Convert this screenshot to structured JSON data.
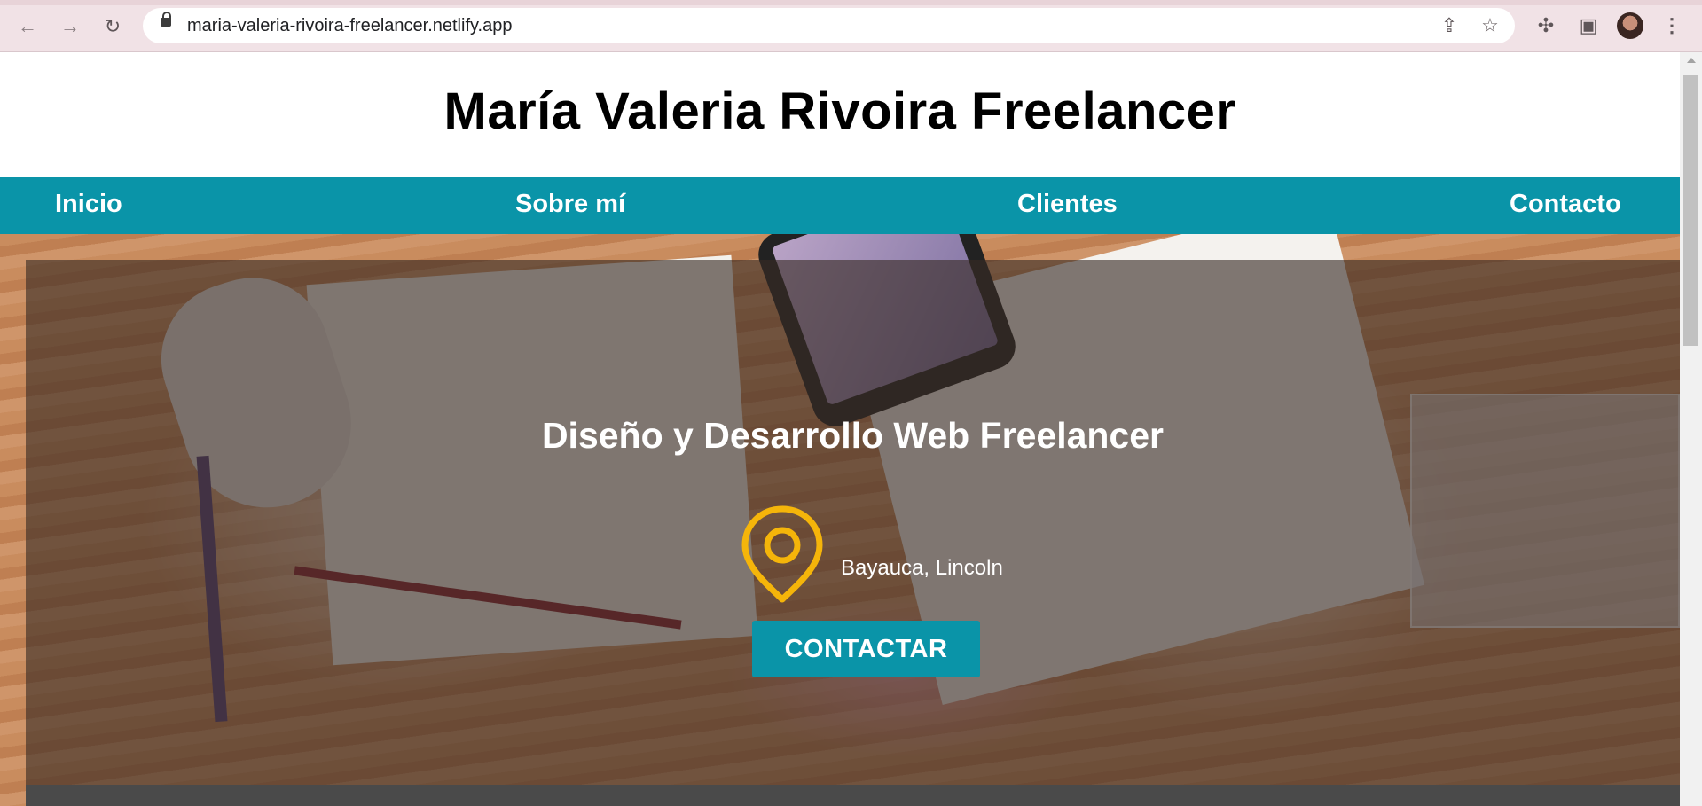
{
  "browser": {
    "url": "maria-valeria-rivoira-freelancer.netlify.app",
    "icons": [
      "back-icon",
      "forward-icon",
      "reload-icon",
      "lock-icon",
      "share-icon",
      "star-icon",
      "extensions-icon",
      "side-panel-icon",
      "avatar",
      "menu-icon"
    ],
    "glyphs": {
      "back": "←",
      "forward": "→",
      "reload": "↻",
      "share": "⇪",
      "star": "☆",
      "extensions": "✣",
      "side_panel": "▣",
      "menu": "⋮"
    }
  },
  "site": {
    "title": "María Valeria Rivoira Freelancer",
    "nav": [
      "Inicio",
      "Sobre mí",
      "Clientes",
      "Contacto"
    ]
  },
  "hero": {
    "headline": "Diseño y Desarrollo Web Freelancer",
    "location": "Bayauca, Lincoln",
    "button": "CONTACTAR"
  },
  "colors": {
    "accent": "#0a94a8",
    "pin": "#f5b50a",
    "overlay": "#372a24"
  }
}
